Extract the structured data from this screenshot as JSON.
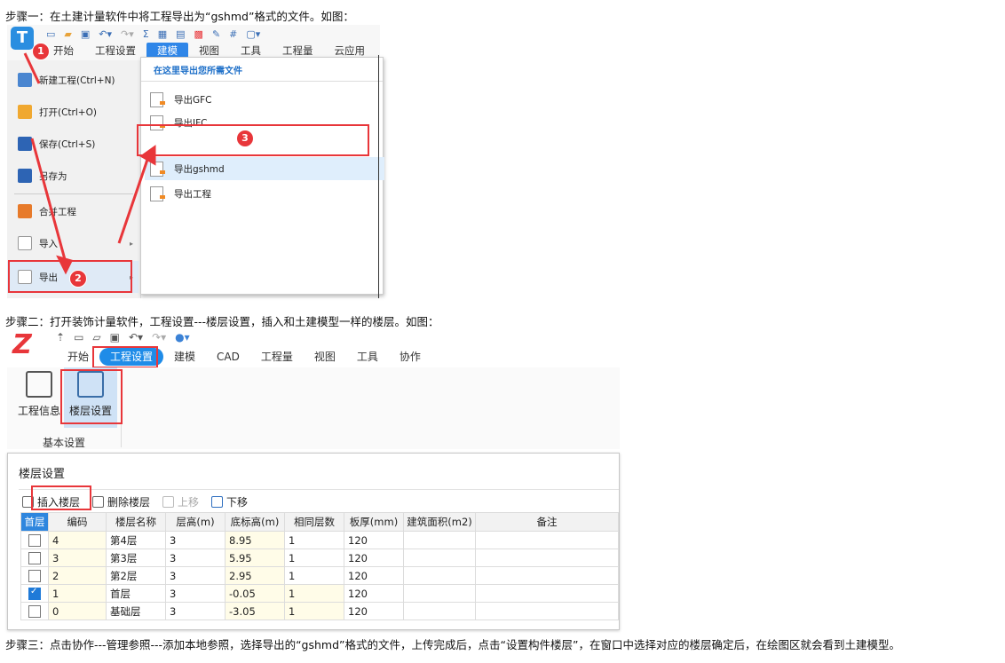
{
  "steps": {
    "step1": "步骤一：在土建计量软件中将工程导出为“gshmd”格式的文件。如图：",
    "step2": "步骤二：打开装饰计量软件，工程设置---楼层设置，插入和土建模型一样的楼层。如图：",
    "step3": "步骤三：点击协作---管理参照---添加本地参照，选择导出的“gshmd”格式的文件，上传完成后，点击“设置构件楼层”，在窗口中选择对应的楼层确定后，在绘图区就会看到土建模型。"
  },
  "shot1": {
    "app_logo": "T",
    "tabs": [
      "开始",
      "工程设置",
      "建模",
      "视图",
      "工具",
      "工程量",
      "云应用"
    ],
    "active_tab_index": 2,
    "left_menu": [
      "新建工程(Ctrl+N)",
      "打开(Ctrl+O)",
      "保存(Ctrl+S)",
      "另存为",
      "合并工程",
      "导入",
      "导出"
    ],
    "right_header": "在这里导出您所需文件",
    "right_items": [
      "导出GFC",
      "导出IFC",
      "导出gshmd",
      "导出工程"
    ],
    "badges": [
      "1",
      "2",
      "3"
    ],
    "accent": "#2f86e8",
    "highlight": "#e8363a"
  },
  "shot2": {
    "app_logo": "Z",
    "tabs": [
      "开始",
      "工程设置",
      "建模",
      "CAD",
      "工程量",
      "视图",
      "工具",
      "协作"
    ],
    "active_tab_index": 1,
    "ribbon_buttons": [
      "工程信息",
      "楼层设置"
    ],
    "ribbon_group": "基本设置",
    "panel_title": "楼层设置",
    "toolbar": [
      "插入楼层",
      "删除楼层",
      "上移",
      "下移"
    ],
    "table": {
      "headers": [
        "首层",
        "编码",
        "楼层名称",
        "层高(m)",
        "底标高(m)",
        "相同层数",
        "板厚(mm)",
        "建筑面积(m2)",
        "备注"
      ],
      "rows": [
        {
          "checked": false,
          "code": "4",
          "name": "第4层",
          "height": "3",
          "base": "8.95",
          "same": "1",
          "thick": "120"
        },
        {
          "checked": false,
          "code": "3",
          "name": "第3层",
          "height": "3",
          "base": "5.95",
          "same": "1",
          "thick": "120"
        },
        {
          "checked": false,
          "code": "2",
          "name": "第2层",
          "height": "3",
          "base": "2.95",
          "same": "1",
          "thick": "120"
        },
        {
          "checked": true,
          "code": "1",
          "name": "首层",
          "height": "3",
          "base": "-0.05",
          "same": "1",
          "thick": "120"
        },
        {
          "checked": false,
          "code": "0",
          "name": "基础层",
          "height": "3",
          "base": "-3.05",
          "same": "1",
          "thick": "120"
        }
      ]
    },
    "accent": "#1f8ce8"
  }
}
